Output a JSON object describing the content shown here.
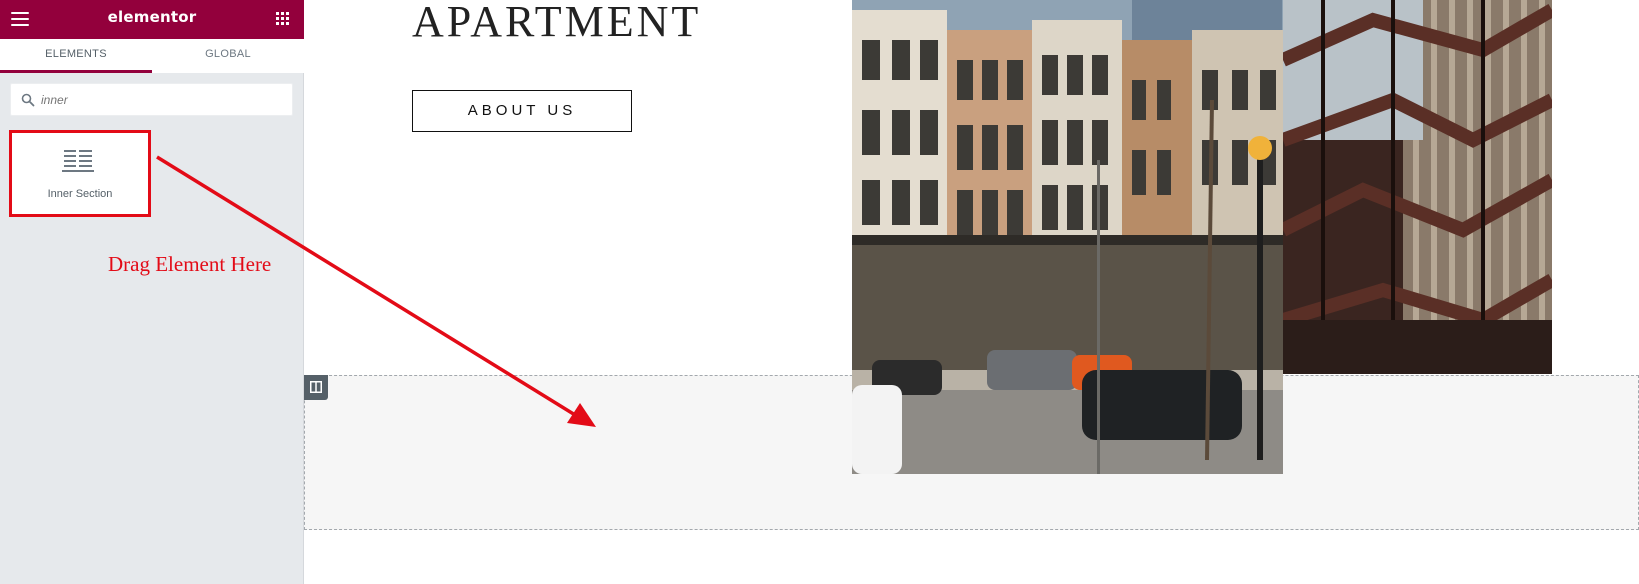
{
  "app": {
    "logo": "elementor"
  },
  "tabs": [
    {
      "label": "ELEMENTS",
      "active": true
    },
    {
      "label": "GLOBAL",
      "active": false
    }
  ],
  "search": {
    "placeholder": "inner",
    "value": ""
  },
  "widget": {
    "label": "Inner Section",
    "icon": "inner-section-icon"
  },
  "annotation": {
    "text": "Drag Element Here",
    "color": "#e30b17"
  },
  "page": {
    "heading": "APARTMENT",
    "button_label": "ABOUT US"
  },
  "colors": {
    "brand": "#93003c",
    "panel": "#e6e9ec",
    "accent_red": "#e30b17"
  }
}
